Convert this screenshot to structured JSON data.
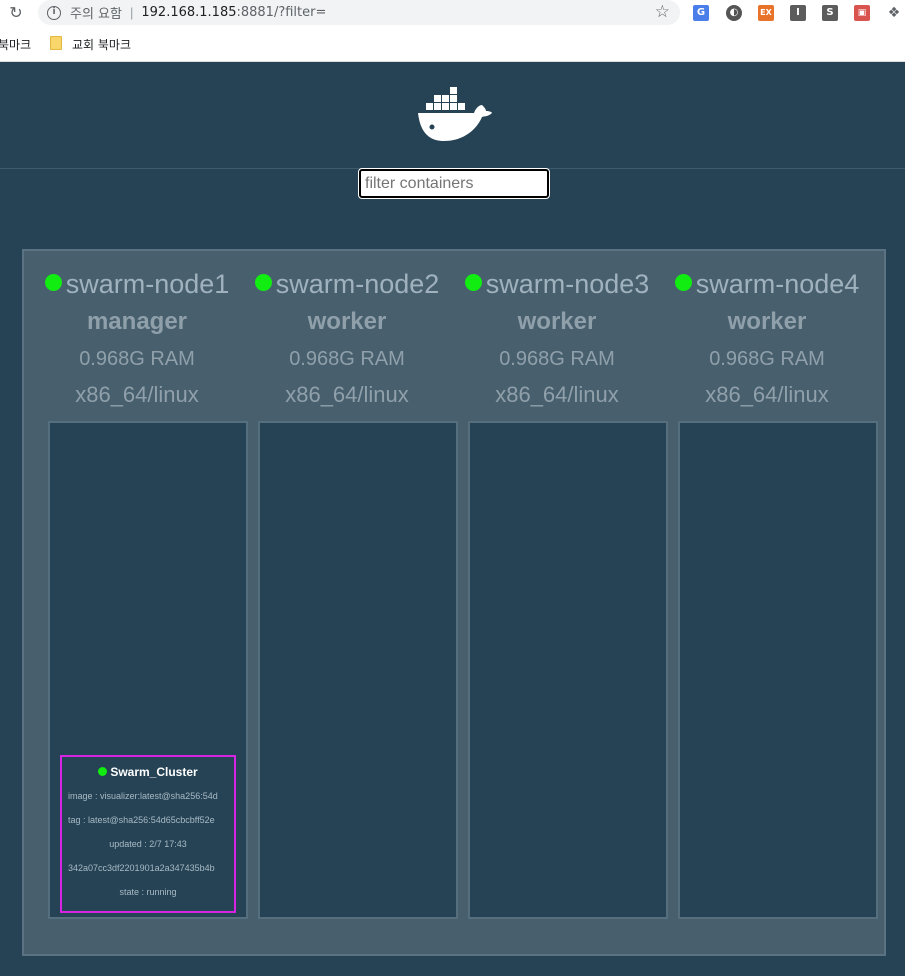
{
  "browser": {
    "security_text": "주의 요함",
    "url_host": "192.168.1.185",
    "url_rest": ":8881/?filter=",
    "bookmark_cut": "북마크",
    "bookmark_folder": "교회 북마크"
  },
  "filter": {
    "placeholder": "filter containers"
  },
  "nodes": [
    {
      "name": "swarm-node1",
      "role": "manager",
      "ram": "0.968G RAM",
      "os": "x86_64/linux",
      "status_color": "#11ec11"
    },
    {
      "name": "swarm-node2",
      "role": "worker",
      "ram": "0.968G RAM",
      "os": "x86_64/linux",
      "status_color": "#11ec11"
    },
    {
      "name": "swarm-node3",
      "role": "worker",
      "ram": "0.968G RAM",
      "os": "x86_64/linux",
      "status_color": "#11ec11"
    },
    {
      "name": "swarm-node4",
      "role": "worker",
      "ram": "0.968G RAM",
      "os": "x86_64/linux",
      "status_color": "#11ec11"
    }
  ],
  "container": {
    "name": "Swarm_Cluster",
    "image": "image : visualizer:latest@sha256:54d",
    "tag": "tag : latest@sha256:54d65cbcbff52e",
    "updated": "updated : 2/7 17:43",
    "id": "342a07cc3df2201901a2a347435b4b",
    "state": "state : running",
    "border_color": "#d623e4"
  },
  "colors": {
    "background": "#254355",
    "cluster_bg": "#485f6e",
    "status_green": "#11ec11"
  }
}
